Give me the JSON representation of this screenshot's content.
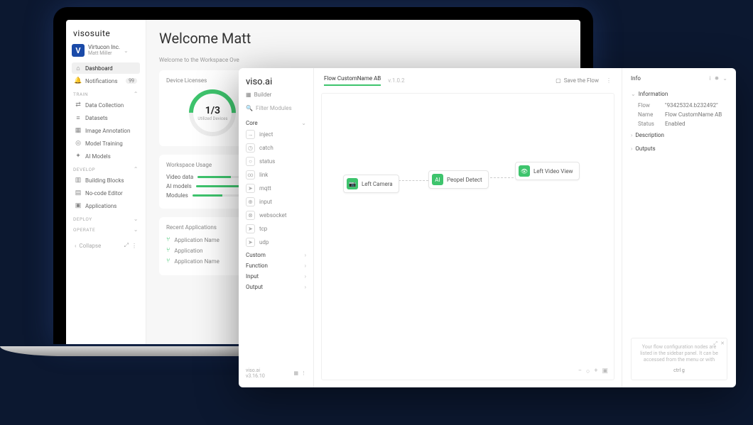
{
  "suite": {
    "logo": "visosuite",
    "org": {
      "initial": "V",
      "name": "Virtucon Inc.",
      "user": "Matt Miller"
    },
    "nav": {
      "dashboard": "Dashboard",
      "notifications": "Notifications",
      "notif_count": "99"
    },
    "train": {
      "header": "TRAIN",
      "items": [
        "Data Collection",
        "Datasets",
        "Image Annotation",
        "Model Training",
        "AI Models"
      ]
    },
    "develop": {
      "header": "DEVELOP",
      "items": [
        "Building Blocks",
        "No-code Editor",
        "Applications"
      ]
    },
    "deploy_header": "DEPLOY",
    "operate_header": "OPERATE",
    "collapse": "Collapse"
  },
  "main": {
    "welcome": "Welcome Matt",
    "subtitle": "Welcome to the Workspace Ove",
    "licenses": {
      "title": "Device Licenses",
      "ratio": "1/3",
      "label": "Utilized Devices"
    },
    "usage": {
      "title": "Workspace Usage",
      "rows": [
        "Video data",
        "AI models",
        "Modules"
      ]
    },
    "recent": {
      "title": "Recent Applications",
      "rows": [
        "Application Name",
        "Application",
        "Application Name"
      ]
    }
  },
  "builder": {
    "logo": "viso.ai",
    "sub": "Builder",
    "filter_ph": "Filter Modules",
    "groups": {
      "core": "Core",
      "custom": "Custom",
      "function": "Function",
      "input": "Input",
      "output": "Output"
    },
    "core_items": [
      "inject",
      "catch",
      "status",
      "link",
      "mqtt",
      "input",
      "websocket",
      "tcp",
      "udp"
    ],
    "footer": {
      "brand": "viso.ai",
      "ver": "v3.16.10"
    }
  },
  "canvas": {
    "flow_name": "Flow CustomName AB",
    "flow_ver": "v.1.0.2",
    "save_label": "Save the Flow",
    "nodes": {
      "left_camera": "Left Camera",
      "people_detect": "Peopel Detect",
      "left_video": "AI",
      "left_video_label": "Left Video View"
    }
  },
  "info": {
    "title": "Info",
    "section_info": "Information",
    "flow_k": "Flow",
    "flow_v": "\"93425324.b232492\"",
    "name_k": "Name",
    "name_v": "Flow CustomName AB",
    "status_k": "Status",
    "status_v": "Enabled",
    "section_desc": "Description",
    "section_outputs": "Outputs",
    "hint": "Your flow configuration nodes are listed in the sidebar panel. It can be accessed from the menu or with",
    "hint_key": "ctrl g"
  }
}
